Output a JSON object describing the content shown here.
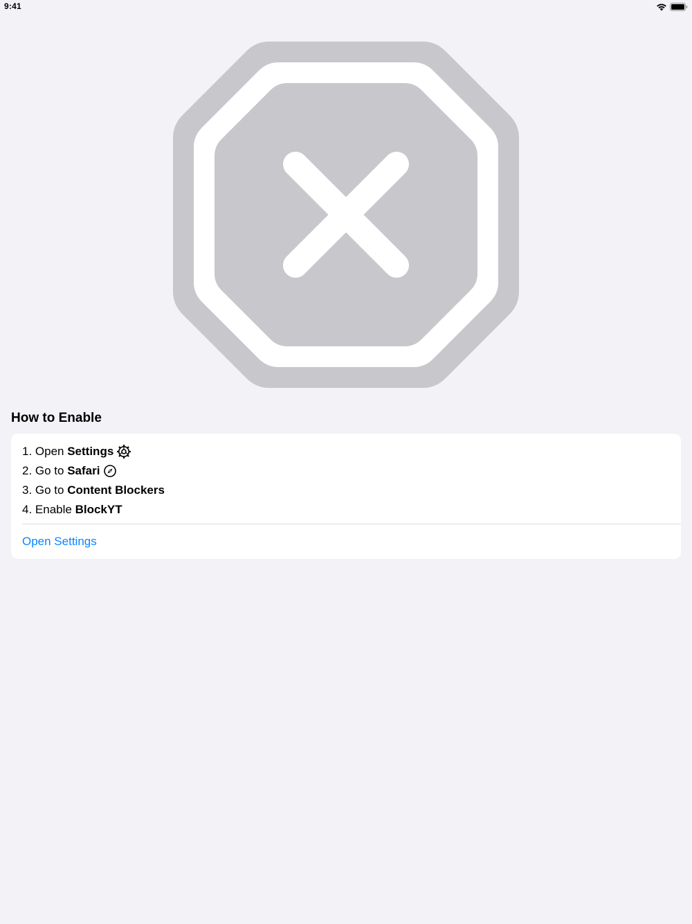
{
  "status_bar": {
    "time": "9:41",
    "wifi_icon": "wifi-icon",
    "battery_icon": "battery-icon"
  },
  "hero": {
    "icon": "xmark-octagon-icon",
    "colors": {
      "outer": "#c7c7cc",
      "ring": "#ffffff",
      "inner": "#c7c7cc",
      "mark": "#ffffff"
    }
  },
  "section": {
    "title": "How to Enable"
  },
  "steps": [
    {
      "prefix": "1. Open ",
      "bold": "Settings",
      "icon": "gear-icon"
    },
    {
      "prefix": "2. Go to ",
      "bold": "Safari",
      "icon": "compass-icon"
    },
    {
      "prefix": "3. Go to ",
      "bold": "Content Blockers",
      "icon": ""
    },
    {
      "prefix": "4. Enable ",
      "bold": "BlockYT",
      "icon": ""
    }
  ],
  "actions": {
    "open_settings_label": "Open Settings"
  },
  "colors": {
    "background": "#f2f2f7",
    "card": "#ffffff",
    "accent": "#0a84ff",
    "divider": "#dcdce0"
  }
}
